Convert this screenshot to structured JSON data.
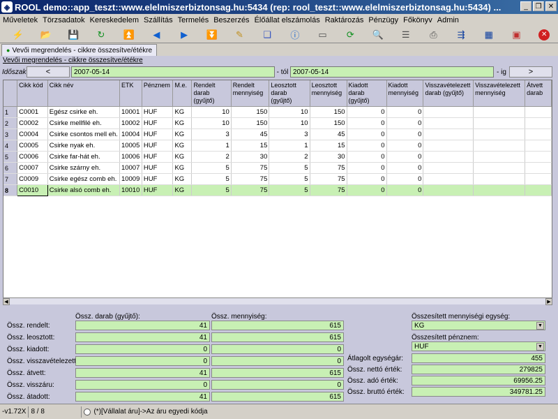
{
  "window": {
    "title": "ROOL demo::app_teszt::www.elelmiszerbiztonsag.hu:5434 (rep: rool_teszt::www.elelmiszerbiztonsag.hu:5434) ..."
  },
  "menu": [
    "Műveletek",
    "Törzsadatok",
    "Kereskedelem",
    "Szállítás",
    "Termelés",
    "Beszerzés",
    "Élőállat elszámolás",
    "Raktározás",
    "Pénzügy",
    "Főkönyv",
    "Admin"
  ],
  "toolbar_icons": [
    "lightning-icon",
    "open-icon",
    "save-icon",
    "refresh-icon",
    "first-icon",
    "prev-icon",
    "next-icon",
    "last-icon",
    "edit-icon",
    "copy-icon",
    "info-icon",
    "window-icon",
    "sync-icon",
    "search-icon",
    "list-icon",
    "print-icon",
    "export-icon",
    "grid-icon",
    "calendar-icon",
    "close-icon"
  ],
  "tab": {
    "label": "Vevői megrendelés - cikkre összesítve/étékre"
  },
  "breadcrumb": "Vevői megrendelés - cikkre összesítve/étékre",
  "period": {
    "label": "Időszak:",
    "prev": "<",
    "from": "2007-05-14",
    "from_suffix": "- tól",
    "to": "2007-05-14",
    "to_suffix": "- ig",
    "next": ">"
  },
  "grid": {
    "columns": [
      "Cikk kód",
      "Cikk név",
      "ETK",
      "Pénznem",
      "M.e.",
      "Rendelt darab (gyűjtő)",
      "Rendelt mennyiség",
      "Leosztott darab (gyűjtő)",
      "Leosztott mennyiség",
      "Kiadott darab (gyűjtő)",
      "Kiadott mennyiség",
      "Visszavételezett darab (gyűjtő)",
      "Visszavételezett mennyiség",
      "Átvett darab"
    ],
    "rows": [
      [
        "1",
        "C0001",
        "Egész csirke eh.",
        "10001",
        "HUF",
        "KG",
        "10",
        "150",
        "10",
        "150",
        "0",
        "0",
        "",
        ""
      ],
      [
        "2",
        "C0002",
        "Csirke mellfilé eh.",
        "10002",
        "HUF",
        "KG",
        "10",
        "150",
        "10",
        "150",
        "0",
        "0",
        "",
        ""
      ],
      [
        "3",
        "C0004",
        "Csirke csontos mell eh.",
        "10004",
        "HUF",
        "KG",
        "3",
        "45",
        "3",
        "45",
        "0",
        "0",
        "",
        ""
      ],
      [
        "4",
        "C0005",
        "Csirke nyak eh.",
        "10005",
        "HUF",
        "KG",
        "1",
        "15",
        "1",
        "15",
        "0",
        "0",
        "",
        ""
      ],
      [
        "5",
        "C0006",
        "Csirke far-hát eh.",
        "10006",
        "HUF",
        "KG",
        "2",
        "30",
        "2",
        "30",
        "0",
        "0",
        "",
        ""
      ],
      [
        "6",
        "C0007",
        "Csirke szárny eh.",
        "10007",
        "HUF",
        "KG",
        "5",
        "75",
        "5",
        "75",
        "0",
        "0",
        "",
        ""
      ],
      [
        "7",
        "C0009",
        "Csirke egész comb eh.",
        "10009",
        "HUF",
        "KG",
        "5",
        "75",
        "5",
        "75",
        "0",
        "0",
        "",
        ""
      ],
      [
        "8",
        "C0010",
        "Csirke alsó comb eh.",
        "10010",
        "HUF",
        "KG",
        "5",
        "75",
        "5",
        "75",
        "0",
        "0",
        "",
        ""
      ]
    ]
  },
  "summary": {
    "col1_header": "Össz. darab (gyűjtő):",
    "col2_header": "Össz. mennyiség:",
    "rows": [
      {
        "label": "Össz. rendelt:",
        "darab": "41",
        "menny": "615"
      },
      {
        "label": "Össz. leosztott:",
        "darab": "41",
        "menny": "615"
      },
      {
        "label": "Össz. kiadott:",
        "darab": "0",
        "menny": "0"
      },
      {
        "label": "Össz. visszavételezett:",
        "darab": "0",
        "menny": "0"
      },
      {
        "label": "Össz. átvett:",
        "darab": "41",
        "menny": "615"
      },
      {
        "label": "Össz. visszáru:",
        "darab": "0",
        "menny": "0"
      },
      {
        "label": "Össz. átadott:",
        "darab": "41",
        "menny": "615"
      }
    ],
    "unit_label": "Összesített mennyiségi egység:",
    "unit_value": "KG",
    "currency_label": "Összesített pénznem:",
    "currency_value": "HUF",
    "avg_price_label": "Átlagolt egységár:",
    "avg_price": "455",
    "net_label": "Össz. nettó érték:",
    "net": "279825",
    "tax_label": "Össz. adó érték:",
    "tax": "69956.25",
    "gross_label": "Össz. bruttó érték:",
    "gross": "349781.25"
  },
  "status": {
    "version": "-v1.72X",
    "count": "8 / 8",
    "hint": "(*)[Vállalat áru]->Az áru egyedi kódja"
  }
}
